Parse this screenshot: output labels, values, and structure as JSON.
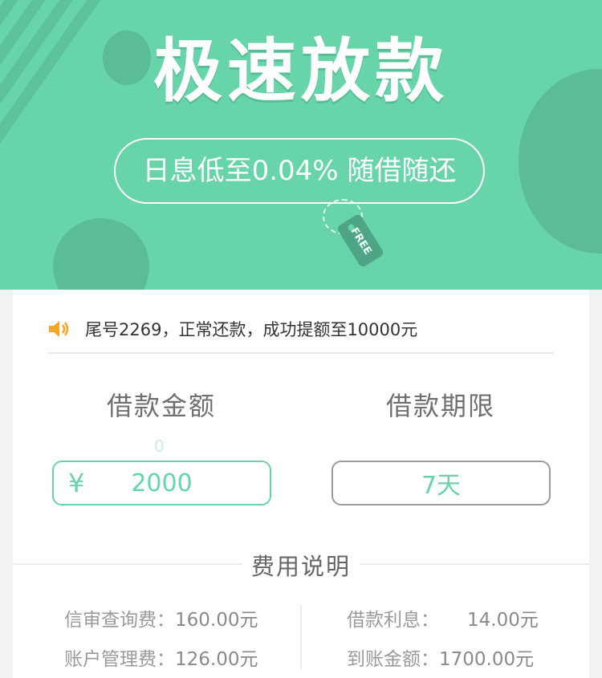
{
  "banner": {
    "headline": "极速放款",
    "subtitle": "日息低至0.04% 随借随还",
    "tag_text": "FREE",
    "colors": {
      "background": "#68d4aa",
      "accent": "#5abd95"
    }
  },
  "notice": {
    "icon": "speaker-icon",
    "text": "尾号2269，正常还款，成功提额至10000元"
  },
  "loan": {
    "amount_label": "借款金额",
    "term_label": "借款期限",
    "hint_char": "0",
    "currency_symbol": "¥",
    "amount_value": "2000",
    "term_value": "7天"
  },
  "fees": {
    "title": "费用说明",
    "left": [
      {
        "label": "信审查询费：",
        "value": "160.00元"
      },
      {
        "label": "账户管理费：",
        "value": "126.00元"
      }
    ],
    "right": [
      {
        "label": "借款利息：",
        "value": "14.00元"
      },
      {
        "label": "到账金额：",
        "value": "1700.00元"
      }
    ]
  }
}
